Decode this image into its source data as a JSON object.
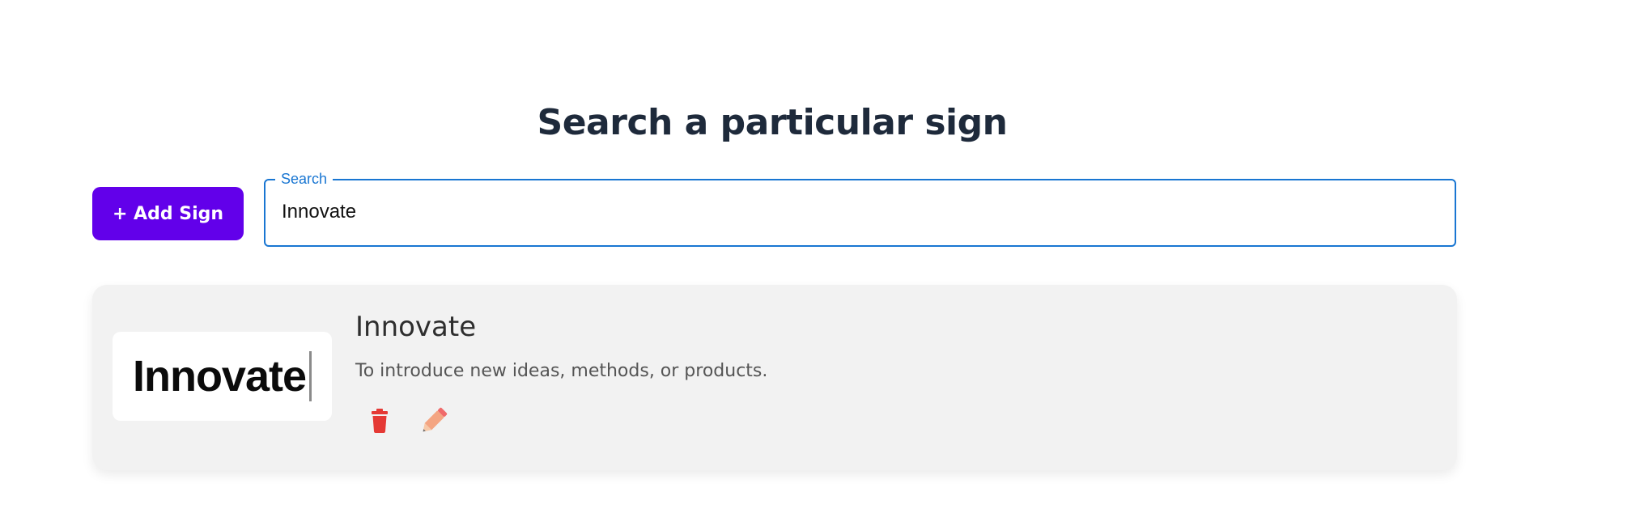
{
  "header": {
    "title": "Search a particular sign"
  },
  "toolbar": {
    "add_label": "+ Add Sign"
  },
  "search": {
    "label": "Search",
    "value": "Innovate"
  },
  "results": [
    {
      "image_text": "Innovate",
      "title": "Innovate",
      "description": "To introduce new ideas, methods, or products.",
      "actions": {
        "delete_icon": "trash-icon",
        "edit_icon": "pencil-icon"
      }
    }
  ],
  "colors": {
    "accent": "#6200ea",
    "focus": "#1976d2",
    "delete": "#e53935",
    "edit": "#f4a582"
  }
}
